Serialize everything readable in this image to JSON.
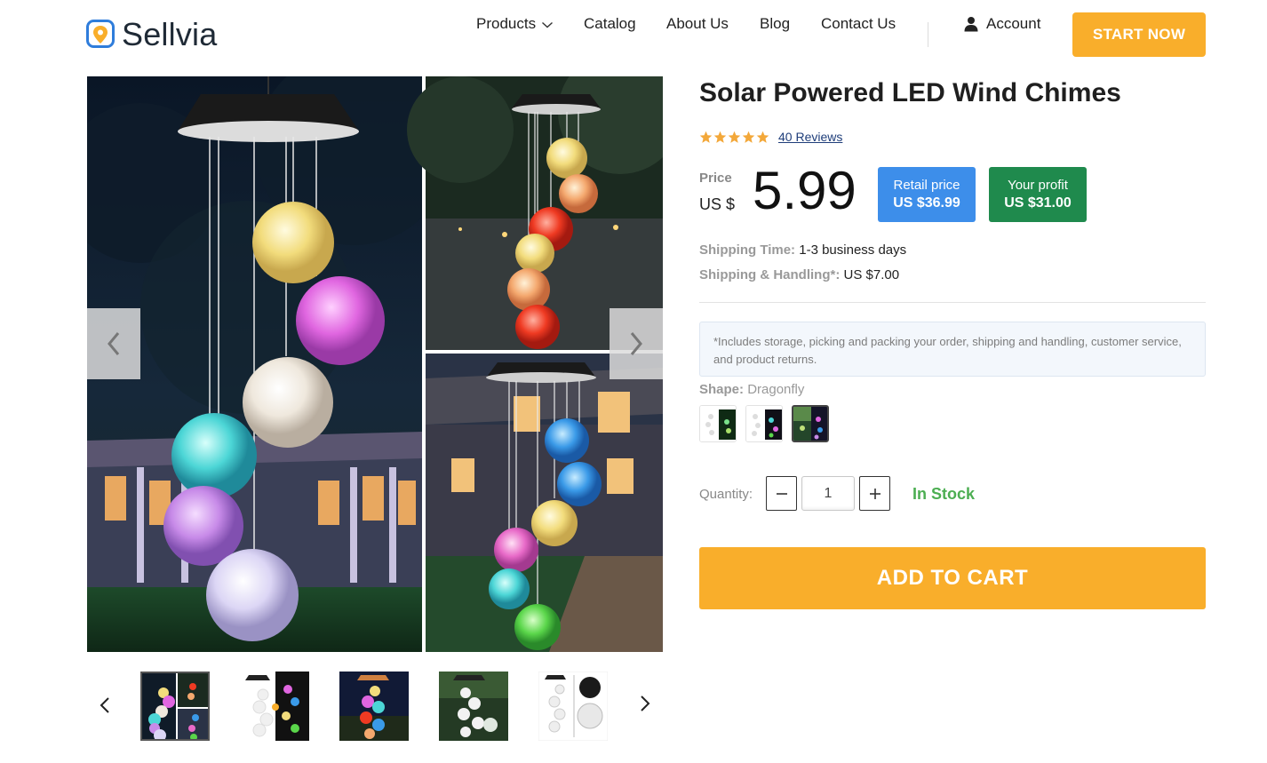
{
  "brand": {
    "name": "Sellvia",
    "logo_icon": "map-pin-logo-icon",
    "accent": "#f9ae2b"
  },
  "nav": {
    "items": [
      {
        "label": "Products",
        "icon": "chevron-down-icon"
      },
      {
        "label": "Catalog"
      },
      {
        "label": "About Us"
      },
      {
        "label": "Blog"
      },
      {
        "label": "Contact Us"
      }
    ],
    "account_label": "Account",
    "account_icon": "user-icon",
    "cta_label": "START NOW"
  },
  "gallery": {
    "prev_icon": "chevron-left-icon",
    "next_icon": "chevron-right-icon",
    "thumbnail_count": 5,
    "active_thumbnail": 1
  },
  "product": {
    "title": "Solar Powered LED Wind Chimes",
    "rating": 5,
    "reviews_label": "40 Reviews",
    "price_label": "Price",
    "currency": "US $",
    "price": "5.99",
    "retail": {
      "label": "Retail price",
      "value": "US $36.99",
      "color": "#3d8eea"
    },
    "profit": {
      "label": "Your profit",
      "value": "US $31.00",
      "color": "#1f8a4d"
    },
    "shipping_time_label": "Shipping Time:",
    "shipping_time_value": "1-3 business days",
    "shipping_handling_label": "Shipping & Handling*:",
    "shipping_handling_value": "US $7.00",
    "note": "*Includes storage, picking and packing your order, shipping and handling, customer service, and product returns.",
    "shape_label": "Shape:",
    "shape_value": "Dragonfly",
    "shape_options": 3,
    "shape_selected": 3,
    "quantity_label": "Quantity:",
    "quantity_value": "1",
    "stock_label": "In Stock",
    "stock_color": "#4cae52",
    "add_to_cart_label": "ADD TO CART"
  }
}
